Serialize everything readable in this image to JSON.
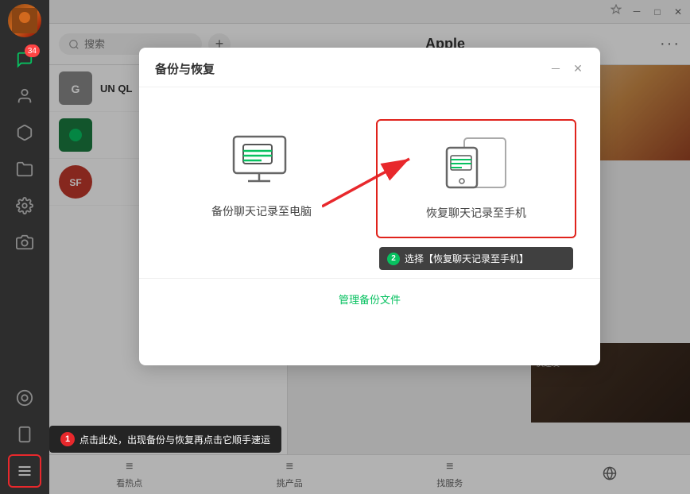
{
  "window": {
    "title": "Apple"
  },
  "header": {
    "search_placeholder": "搜索",
    "add_button": "+",
    "title": "Apple",
    "dots": "···"
  },
  "dialog": {
    "title": "备份与恢复",
    "option1_label": "备份聊天记录至电脑",
    "option2_label": "恢复聊天记录至手机",
    "manage_link": "管理备份文件",
    "tooltip2_badge": "2",
    "tooltip2_text": "选择【恢复聊天记录至手机】"
  },
  "bottom_tooltip": {
    "badge": "1",
    "text": "点击此处，出现备份与恢复再点击它顺手速运"
  },
  "tabs": [
    {
      "icon": "≡",
      "label": "看热点"
    },
    {
      "icon": "≡",
      "label": "挑产品"
    },
    {
      "icon": "≡",
      "label": "找服务"
    },
    {
      "icon": "🌐",
      "label": ""
    }
  ],
  "sidebar": {
    "badge_count": "34",
    "icons": [
      {
        "name": "chat",
        "unicode": "💬"
      },
      {
        "name": "contacts",
        "unicode": "👤"
      },
      {
        "name": "cube",
        "unicode": "⬡"
      },
      {
        "name": "folder",
        "unicode": "🗂"
      },
      {
        "name": "settings",
        "unicode": "⚙"
      },
      {
        "name": "camera",
        "unicode": "📷"
      },
      {
        "name": "app",
        "unicode": "◉"
      },
      {
        "name": "phone",
        "unicode": "📱"
      },
      {
        "name": "menu",
        "unicode": "☰"
      }
    ]
  },
  "chat_items": [
    {
      "color": "#e8282c",
      "label": "G",
      "title": "UN QL"
    },
    {
      "color": "#07c160",
      "label": "●",
      "title": ""
    },
    {
      "color": "#ff6600",
      "label": "SF",
      "title": ""
    }
  ],
  "colors": {
    "accent_green": "#07c160",
    "accent_red": "#e8282c",
    "dialog_border": "#e0231c"
  }
}
